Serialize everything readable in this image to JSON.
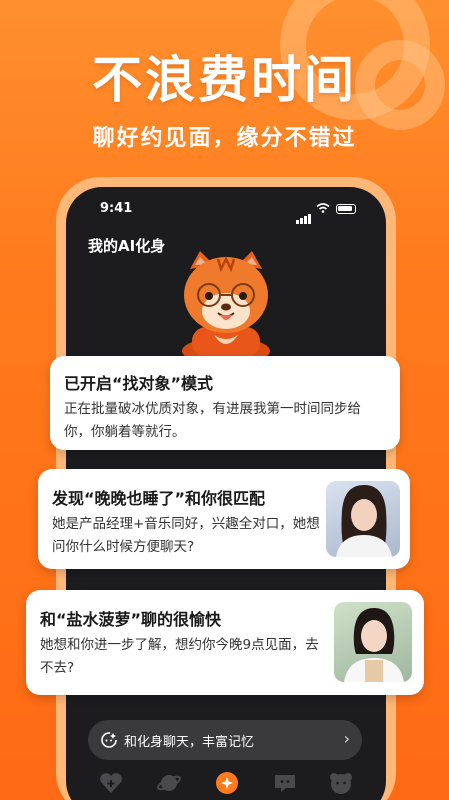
{
  "headline": "不浪费时间",
  "subheadline": "聊好约见面，缘分不错过",
  "colors": {
    "brand": "#ff7a1c",
    "accent": "#ffa24a",
    "dark": "#1c1c1e"
  },
  "status": {
    "time": "9:41"
  },
  "page": {
    "title": "我的AI化身"
  },
  "cards": [
    {
      "title": "已开启“找对象”模式",
      "body": "正在批量破冰优质对象，有进展我第一时间同步给你，你躺着等就行。"
    },
    {
      "title": "发现“晚晚也睡了”和你很匹配",
      "body": "她是产品经理+音乐同好，兴趣全对口，她想问你什么时候方便聊天?"
    },
    {
      "title": "和“盐水菠萝”聊的很愉快",
      "body": "她想和你进一步了解，想约你今晚9点见面，去不去?"
    }
  ],
  "chat_prompt": {
    "label": "和化身聊天，丰富记忆"
  },
  "nav": [
    "heart-plus-icon",
    "planet-icon",
    "plus-icon",
    "chat-icon",
    "bear-icon"
  ]
}
